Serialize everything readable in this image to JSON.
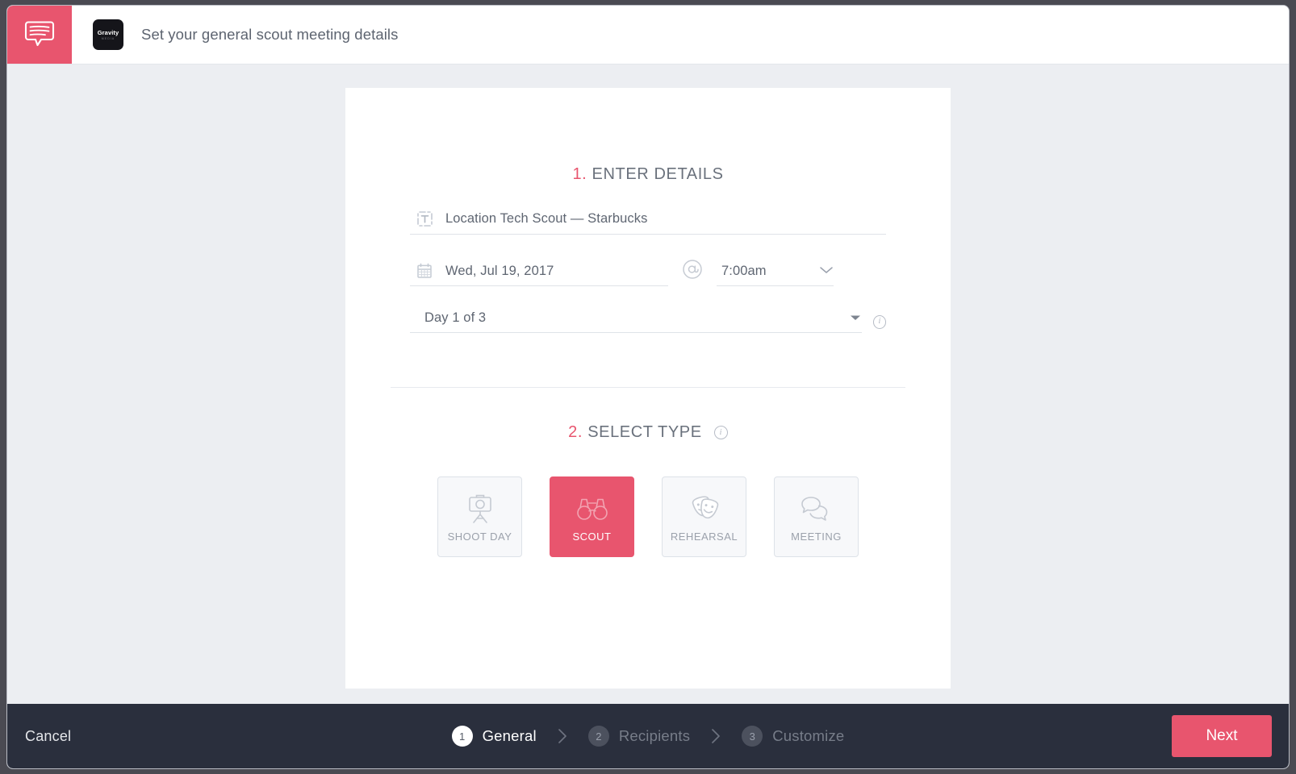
{
  "header": {
    "badge_icon": "speech-bubble-icon",
    "brand_name": "Gravity",
    "brand_sub": "MEDIA",
    "title": "Set your general scout meeting details"
  },
  "main": {
    "step1": {
      "number": "1.",
      "label": "ENTER DETAILS",
      "title_field": {
        "icon": "text-field-icon",
        "value": "Location Tech Scout — Starbucks"
      },
      "date_field": {
        "icon": "calendar-icon",
        "value": "Wed, Jul 19, 2017"
      },
      "at_symbol": "@",
      "time_field": {
        "value": "7:00am",
        "chevron": "chevron-down-icon"
      },
      "day_field": {
        "value": "Day 1 of 3",
        "caret": "caret-down-icon",
        "info": "i"
      }
    },
    "step2": {
      "number": "2.",
      "label": "SELECT TYPE",
      "info": "i",
      "types": [
        {
          "label": "SHOOT DAY",
          "icon": "camera-tripod-icon",
          "selected": false
        },
        {
          "label": "SCOUT",
          "icon": "binoculars-icon",
          "selected": true
        },
        {
          "label": "REHEARSAL",
          "icon": "theater-masks-icon",
          "selected": false
        },
        {
          "label": "MEETING",
          "icon": "speech-bubbles-icon",
          "selected": false
        }
      ]
    }
  },
  "footer": {
    "cancel_label": "Cancel",
    "next_label": "Next",
    "steps": [
      {
        "num": "1",
        "label": "General",
        "active": true
      },
      {
        "num": "2",
        "label": "Recipients",
        "active": false
      },
      {
        "num": "3",
        "label": "Customize",
        "active": false
      }
    ],
    "separator": "chevron-right-icon"
  },
  "colors": {
    "accent": "#e8556e",
    "footer_bg": "#2a2f3d",
    "page_bg": "#eceef2",
    "text": "#5f6672"
  }
}
